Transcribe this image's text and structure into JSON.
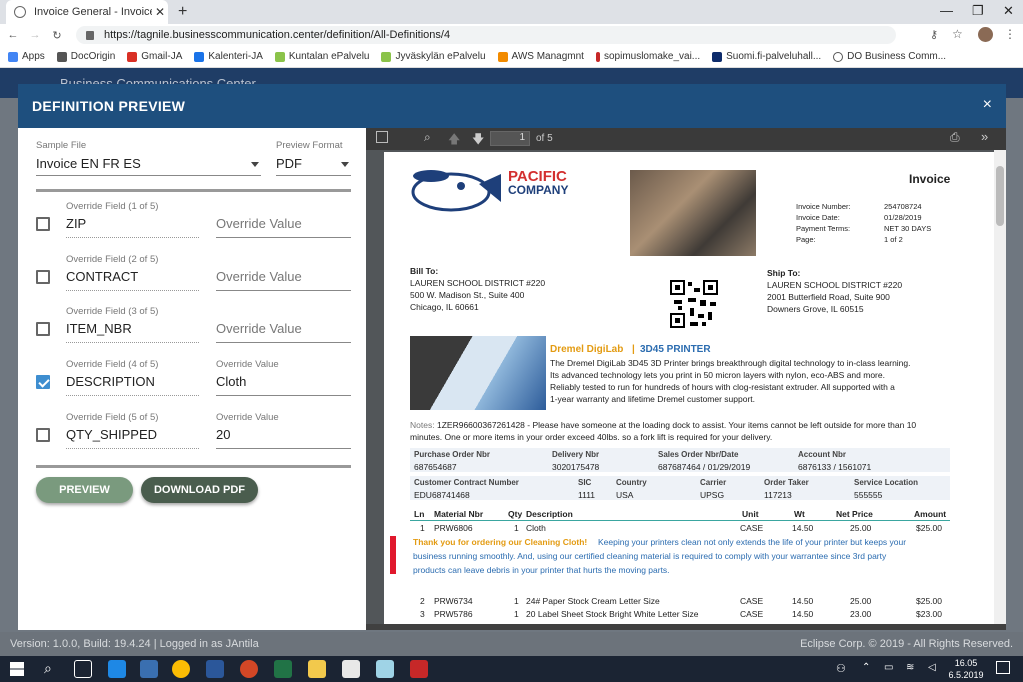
{
  "browser": {
    "tab_title": "Invoice General - Invoice | Busin",
    "url": "https://tagnile.businesscommunication.center/definition/All-Definitions/4",
    "bookmarks": [
      "Apps",
      "DocOrigin",
      "Gmail-JA",
      "Kalenteri-JA",
      "Kuntalan ePalvelu",
      "Jyväskylän ePalvelu",
      "AWS Managmnt",
      "sopimuslomake_vai...",
      "Suomi.fi-palveluhall...",
      "DO Business Comm..."
    ]
  },
  "app": {
    "header_title": "Business Communications Center",
    "footer_left": "Version: 1.0.0, Build: 19.4.24  |  Logged in as JAntila",
    "footer_right": "Eclipse Corp. © 2019 - All Rights Reserved."
  },
  "modal": {
    "title": "DEFINITION PREVIEW",
    "close": "×",
    "sample_file_label": "Sample File",
    "sample_file_value": "Invoice EN FR ES",
    "preview_format_label": "Preview Format",
    "preview_format_value": "PDF",
    "overrides": [
      {
        "label": "Override Field (1 of 5)",
        "field": "ZIP",
        "value_label": "",
        "value": "Override Value",
        "checked": false,
        "placeholder": true
      },
      {
        "label": "Override Field (2 of 5)",
        "field": "CONTRACT",
        "value_label": "",
        "value": "Override Value",
        "checked": false,
        "placeholder": true
      },
      {
        "label": "Override Field (3 of 5)",
        "field": "ITEM_NBR",
        "value_label": "",
        "value": "Override Value",
        "checked": false,
        "placeholder": true
      },
      {
        "label": "Override Field (4 of 5)",
        "field": "DESCRIPTION",
        "value_label": "Override Value",
        "value": "Cloth",
        "checked": true,
        "placeholder": false
      },
      {
        "label": "Override Field (5 of 5)",
        "field": "QTY_SHIPPED",
        "value_label": "Override Value",
        "value": "20",
        "checked": false,
        "placeholder": false
      }
    ],
    "preview_button": "PREVIEW",
    "download_button": "DOWNLOAD PDF"
  },
  "viewer": {
    "page_number": "1",
    "page_total": "of 5"
  },
  "invoice": {
    "company_line1": "PACIFIC",
    "company_line2": "COMPANY",
    "title": "Invoice",
    "meta_labels": [
      "Invoice Number:",
      "Invoice Date:",
      "Payment Terms:",
      "Page:"
    ],
    "meta_values": [
      "254708724",
      "01/28/2019",
      "NET 30 DAYS",
      "1 of 2"
    ],
    "bill_to_label": "Bill To:",
    "bill_to": [
      "LAUREN SCHOOL DISTRICT #220",
      "500 W. Madison St., Suite 400",
      "Chicago, IL 60661"
    ],
    "ship_to_label": "Ship To:",
    "ship_to": [
      "LAUREN SCHOOL DISTRICT #220",
      "2001 Butterfield Road, Suite 900",
      "Downers Grove, IL 60515"
    ],
    "promo_title_a": "Dremel DigiLab",
    "promo_title_sep": "|",
    "promo_title_b": "3D45 PRINTER",
    "promo_text": [
      "The Dremel DigiLab 3D45 3D Printer brings breakthrough digital technology to in-class learning.",
      "Its advanced technology lets you print in 50 micron layers with nylon, eco-ABS and more.",
      "Reliably tested to run for hundreds of hours with clog-resistant extruder. All supported with a",
      "1-year warranty and lifetime Dremel customer support."
    ],
    "notes_label": "Notes:",
    "notes": [
      "1ZER96600367261428 - Please have someone at the loading dock to assist.  Your items cannot be left outside for more than 10",
      "minutes. One or more items in your order exceed 40lbs. so a fork lift is required for your delivery."
    ],
    "row1_labels": [
      "Purchase Order Nbr",
      "Delivery Nbr",
      "Sales Order Nbr/Date",
      "Account Nbr"
    ],
    "row1_values": [
      "687654687",
      "3020175478",
      "687687464 / 01/29/2019",
      "6876133 / 1561071"
    ],
    "row2_labels": [
      "Customer Contract Number",
      "SIC",
      "Country",
      "Carrier",
      "Order Taker",
      "Service Location"
    ],
    "row2_values": [
      "EDU68741468",
      "1111",
      "USA",
      "UPSG",
      "117213",
      "555555"
    ],
    "line_headers": [
      "Ln",
      "Material Nbr",
      "Qty",
      "Description",
      "Unit",
      "Wt",
      "Net Price",
      "Amount"
    ],
    "lines": [
      [
        "1",
        "PRW6806",
        "1",
        "Cloth",
        "CASE",
        "14.50",
        "25.00",
        "$25.00"
      ],
      [
        "2",
        "PRW6734",
        "1",
        "24# Paper Stock Cream Letter Size",
        "CASE",
        "14.50",
        "25.00",
        "$25.00"
      ],
      [
        "3",
        "PRW5786",
        "1",
        "20 Label Sheet Stock Bright White Letter Size",
        "CASE",
        "14.50",
        "23.00",
        "$23.00"
      ]
    ],
    "thanks_bold": "Thank you for ordering our Cleaning Cloth!",
    "thanks_rest": " Keeping your printers clean not only extends the life of your printer but keeps your",
    "thanks_lines": [
      "business running smoothly.  And, using our certified cleaning material is required to comply with your warrantee since 3rd party",
      "products can leave debris in your printer that hurts the moving parts."
    ]
  },
  "taskbar": {
    "time": "16.05",
    "date": "6.5.2019"
  }
}
